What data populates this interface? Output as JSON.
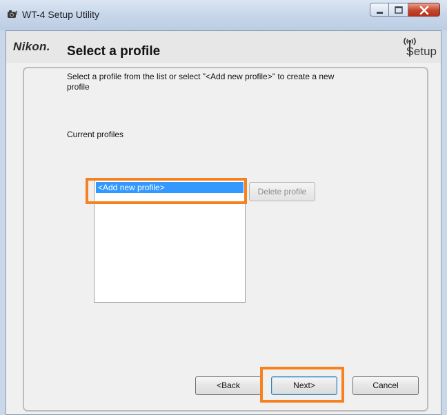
{
  "window": {
    "title": "WT-4 Setup Utility",
    "caption_buttons": [
      "minimize",
      "maximize",
      "close"
    ]
  },
  "header": {
    "brand": "Nikon.",
    "setup_logo": "Setup"
  },
  "main": {
    "title": "Select a profile",
    "description": "Select a profile from the list or select \"<Add new profile>\" to create a new profile",
    "profiles_label": "Current profiles",
    "profiles": [
      "<Add new profile>"
    ],
    "selected_profile": "<Add new profile>",
    "delete_button": "Delete profile"
  },
  "footer": {
    "back": "<Back",
    "next": "Next>",
    "cancel": "Cancel"
  },
  "colors": {
    "highlight": "#f5821f",
    "selection": "#3399ff"
  }
}
